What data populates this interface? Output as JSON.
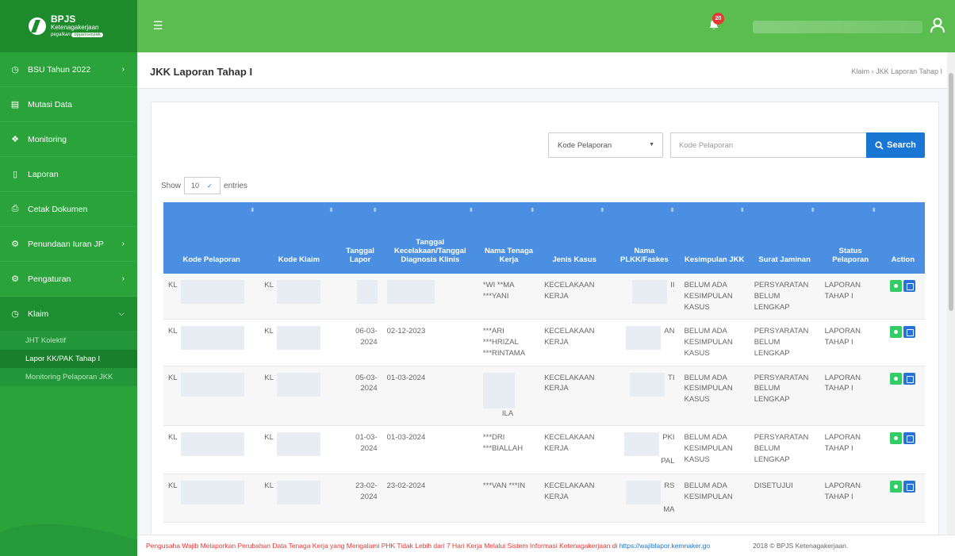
{
  "brand": {
    "name": "BPJS",
    "sub": "Ketenagakerjaan",
    "tag_left": "pegafkan",
    "tag_right": "bpjamsostek"
  },
  "sidebar": {
    "items": [
      {
        "label": "BSU Tahun 2022",
        "icon": "clock-icon",
        "has_chevron": true
      },
      {
        "label": "Mutasi Data",
        "icon": "document-icon",
        "has_chevron": false
      },
      {
        "label": "Monitoring",
        "icon": "monitor-icon",
        "has_chevron": false
      },
      {
        "label": "Laporan",
        "icon": "file-icon",
        "has_chevron": false
      },
      {
        "label": "Cetak Dokumen",
        "icon": "print-icon",
        "has_chevron": false
      },
      {
        "label": "Penundaan Iuran JP",
        "icon": "gear-icon",
        "has_chevron": true
      },
      {
        "label": "Pengaturan",
        "icon": "gear-icon",
        "has_chevron": true
      },
      {
        "label": "Klaim",
        "icon": "clock-icon",
        "has_chevron": true,
        "expanded": true
      }
    ],
    "subitems": [
      "JHT Kolektif",
      "Lapor KK/PAK Tahap I",
      "Monitoring Pelaporan JKK"
    ]
  },
  "topbar": {
    "notification_count": "20"
  },
  "page": {
    "title": "JKK Laporan Tahap I",
    "breadcrumb_root": "Klaim",
    "breadcrumb_sep": "›",
    "breadcrumb_current": "JKK Laporan Tahap I"
  },
  "filter": {
    "select_value": "Kode Pelaporan",
    "search_placeholder": "Kode Pelaporan",
    "search_button": "Search"
  },
  "entries": {
    "show": "Show",
    "value": "10",
    "suffix": "entries"
  },
  "table": {
    "headers": [
      "Kode Pelaporan",
      "Kode Klaim",
      "Tanggal Lapor",
      "Tanggal Kecelakaan/Tanggal Diagnosis Klinis",
      "Nama Tenaga Kerja",
      "Jenis Kasus",
      "Nama PLKK/Faskes",
      "Kesimpulan JKK",
      "Surat Jaminan",
      "Status Pelaporan",
      "Action"
    ],
    "rows": [
      {
        "kode_pelaporan": "KL",
        "kode_klaim": "KL",
        "tanggal_lapor": "",
        "tanggal_kecelakaan": "",
        "nama": "*WI **MA ***YANI",
        "jenis": "KECELAKAAN KERJA",
        "plkk": "II",
        "kesimpulan": "BELUM ADA KESIMPULAN KASUS",
        "surat": "PERSYARATAN BELUM LENGKAP",
        "status": "LAPORAN TAHAP I"
      },
      {
        "kode_pelaporan": "KL",
        "kode_klaim": "KL",
        "tanggal_lapor": "06-03-2024",
        "tanggal_kecelakaan": "02-12-2023",
        "nama": "***ARI ***HRIZAL ***RINTAMA",
        "jenis": "KECELAKAAN KERJA",
        "plkk": "AN",
        "kesimpulan": "BELUM ADA KESIMPULAN KASUS",
        "surat": "PERSYARATAN BELUM LENGKAP",
        "status": "LAPORAN TAHAP I"
      },
      {
        "kode_pelaporan": "KL",
        "kode_klaim": "KL",
        "tanggal_lapor": "05-03-2024",
        "tanggal_kecelakaan": "01-03-2024",
        "nama": "ILA",
        "jenis": "KECELAKAAN KERJA",
        "plkk": "TI",
        "kesimpulan": "BELUM ADA KESIMPULAN KASUS",
        "surat": "PERSYARATAN BELUM LENGKAP",
        "status": "LAPORAN TAHAP I"
      },
      {
        "kode_pelaporan": "KL",
        "kode_klaim": "KL",
        "tanggal_lapor": "01-03-2024",
        "tanggal_kecelakaan": "01-03-2024",
        "nama": "***DRI ***BIALLAH",
        "jenis": "KECELAKAAN KERJA",
        "plkk": "PKI PAL",
        "kesimpulan": "BELUM ADA KESIMPULAN KASUS",
        "surat": "PERSYARATAN BELUM LENGKAP",
        "status": "LAPORAN TAHAP I"
      },
      {
        "kode_pelaporan": "KL",
        "kode_klaim": "KL",
        "tanggal_lapor": "23-02-2024",
        "tanggal_kecelakaan": "23-02-2024",
        "nama": "***VAN ***IN",
        "jenis": "KECELAKAAN KERJA",
        "plkk": "RS MA",
        "kesimpulan": "BELUM ADA KESIMPULAN",
        "surat": "DISETUJUI",
        "status": "LAPORAN TAHAP I"
      }
    ]
  },
  "footer": {
    "notice": "Pengusaha Wajib Melaporkan Perubahan Data Tenaga Kerja yang Mengalami PHK Tidak Lebih dari 7 Hari Kerja Melalui Sistem Informasi Ketenagakerjaan di",
    "link": "https://wajiblapor.kemnaker.go",
    "copyright": "2018 © BPJS Ketenagakerjaan."
  },
  "colors": {
    "sidebar": "#29a33a",
    "topbar": "#5bbd4f",
    "table_header": "#4a8fe2",
    "search_button": "#1976d2"
  }
}
